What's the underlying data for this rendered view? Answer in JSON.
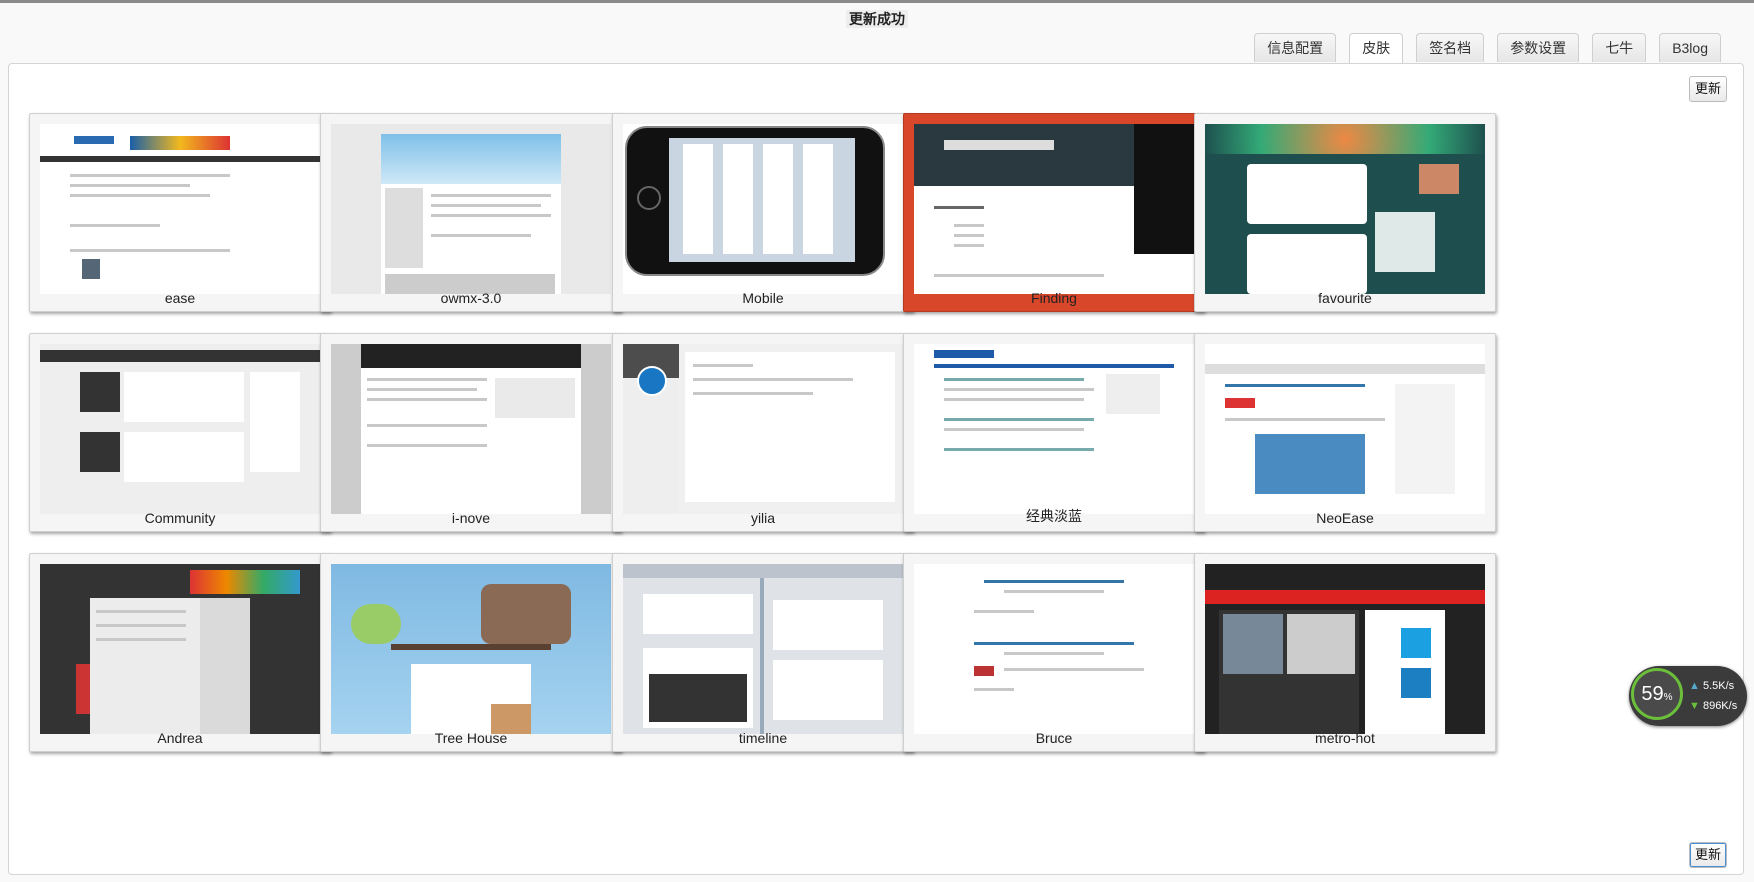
{
  "status_message": "更新成功",
  "tabs": [
    {
      "label": "信息配置",
      "active": false
    },
    {
      "label": "皮肤",
      "active": true
    },
    {
      "label": "签名档",
      "active": false
    },
    {
      "label": "参数设置",
      "active": false
    },
    {
      "label": "七牛",
      "active": false
    },
    {
      "label": "B3log",
      "active": false
    }
  ],
  "buttons": {
    "update_top": "更新",
    "update_bottom": "更新"
  },
  "skins": [
    {
      "name": "ease",
      "selected": false
    },
    {
      "name": "owmx-3.0",
      "selected": false
    },
    {
      "name": "Mobile",
      "selected": false
    },
    {
      "name": "Finding",
      "selected": true
    },
    {
      "name": "favourite",
      "selected": false
    },
    {
      "name": "Community",
      "selected": false
    },
    {
      "name": "i-nove",
      "selected": false
    },
    {
      "name": "yilia",
      "selected": false
    },
    {
      "name": "经典淡蓝",
      "selected": false
    },
    {
      "name": "NeoEase",
      "selected": false
    },
    {
      "name": "Andrea",
      "selected": false
    },
    {
      "name": "Tree House",
      "selected": false
    },
    {
      "name": "timeline",
      "selected": false
    },
    {
      "name": "Bruce",
      "selected": false
    },
    {
      "name": "metro-hot",
      "selected": false
    }
  ],
  "network_widget": {
    "percent": "59",
    "percent_unit": "%",
    "upload": "5.5K/s",
    "download": "896K/s"
  },
  "colors": {
    "selected_skin": "#d9472b",
    "accent": "#6bbf3a"
  }
}
